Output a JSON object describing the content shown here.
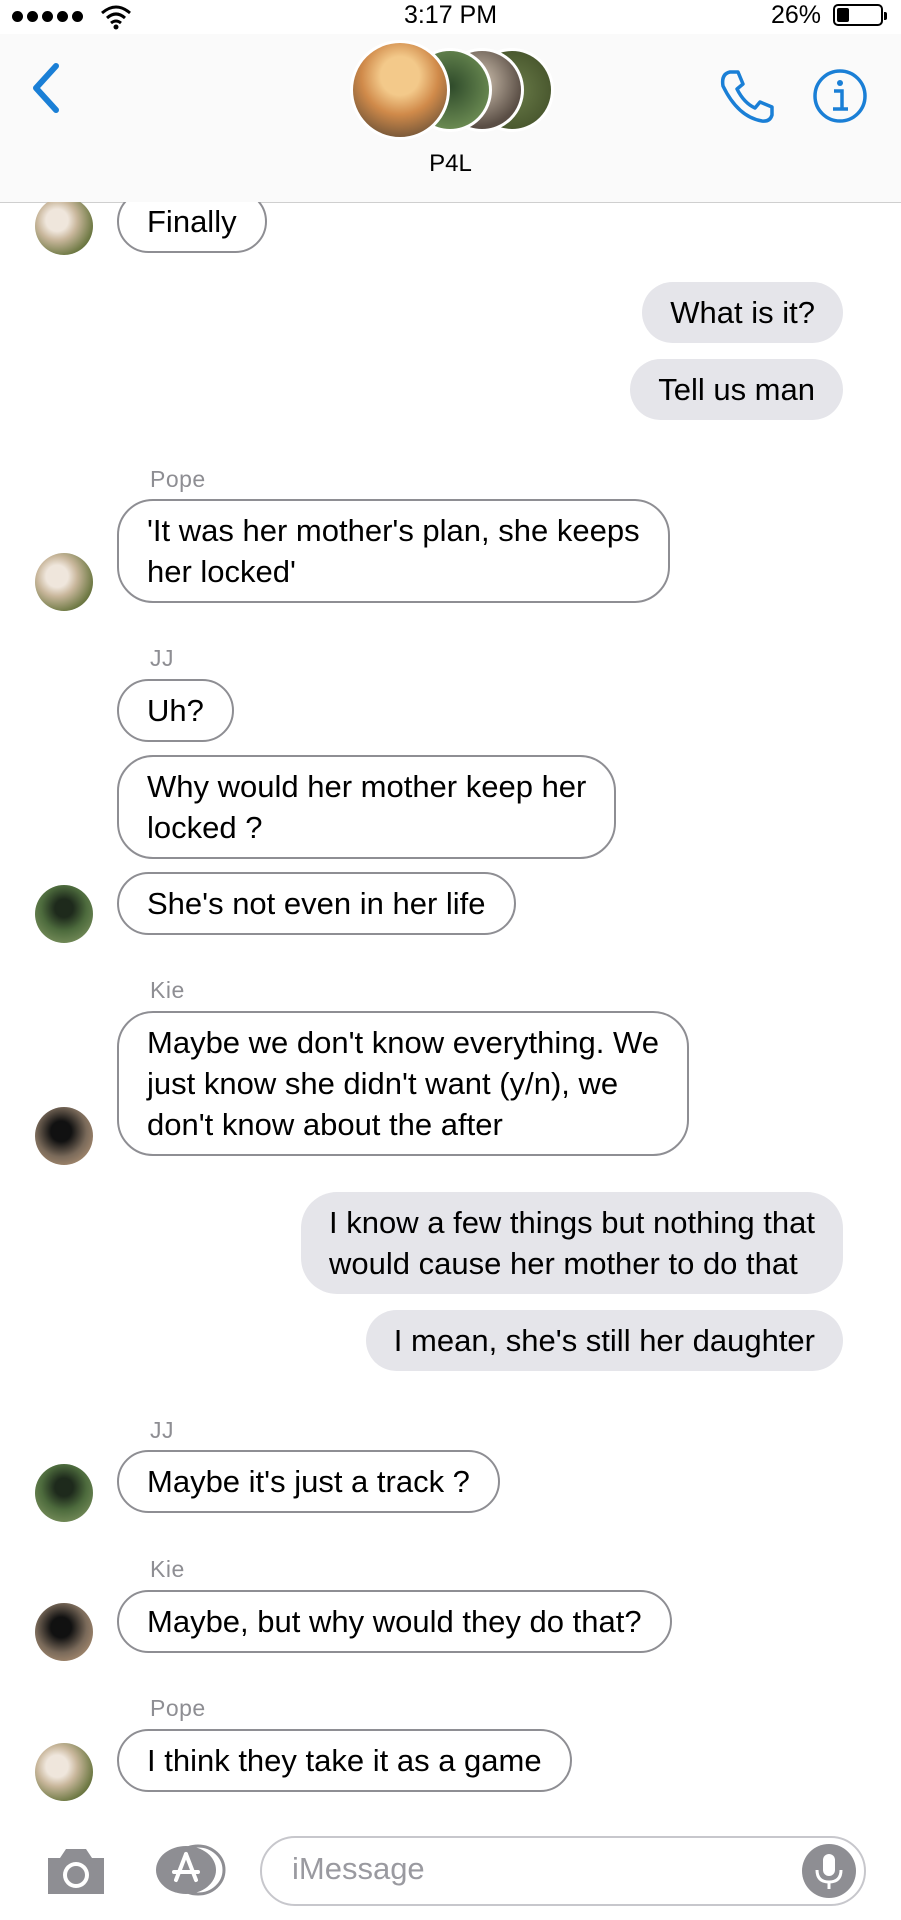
{
  "status_bar": {
    "time": "3:17 PM",
    "battery_text": "26%",
    "battery_level": 0.26,
    "signal_bars": 5
  },
  "header": {
    "group_name": "P4L",
    "back_icon": "chevron-left-icon",
    "call_icon": "phone-icon",
    "info_icon": "info-icon"
  },
  "messages": {
    "m1": "Finally",
    "m2": "What is it?",
    "m3": "Tell us man",
    "s_pope_1": "Pope",
    "m4_l1": "'It was her mother's plan, she keeps",
    "m4_l2": "her locked'",
    "s_jj_1": "JJ",
    "m5": "Uh?",
    "m6_l1": "Why would her mother keep her",
    "m6_l2": "locked ?",
    "m7": "She's not even in her life",
    "s_kie_1": "Kie",
    "m8_l1": "Maybe we don't know everything. We",
    "m8_l2": "just know she didn't want (y/n), we",
    "m8_l3": "don't know about the after",
    "m9_l1": "I know a few things but nothing that",
    "m9_l2": "would cause her mother to do that",
    "m10": "I mean, she's still her daughter",
    "s_jj_2": "JJ",
    "m11": "Maybe it's just a track ?",
    "s_kie_2": "Kie",
    "m12": "Maybe, but why would they do that?",
    "s_pope_2": "Pope",
    "m13": "I think they take it as a game"
  },
  "compose": {
    "placeholder": "iMessage"
  },
  "colors": {
    "accent": "#1a7fd6",
    "incoming_border": "#8e8e93",
    "outgoing_bg": "#e5e5ea",
    "sender_gray": "#8e8e93"
  }
}
